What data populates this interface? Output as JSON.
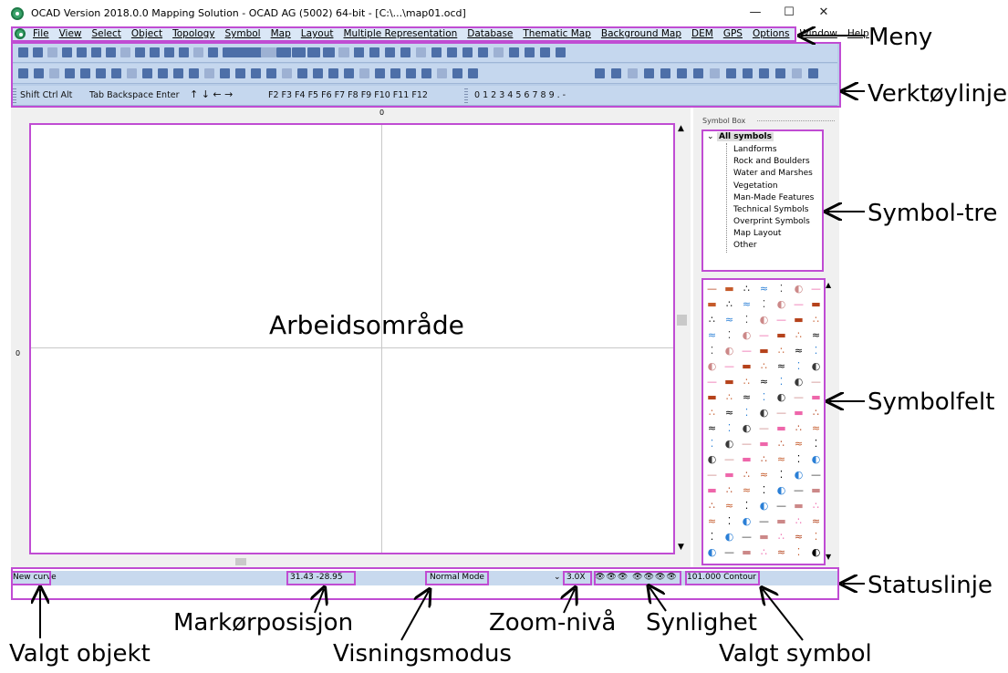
{
  "titlebar": {
    "title": "OCAD Version 2018.0.0  Mapping Solution - OCAD AG (5002) 64-bit - [C:\\...\\map01.ocd]",
    "minimize": "—",
    "maximize": "☐",
    "close": "✕"
  },
  "menu": {
    "items": [
      "File",
      "View",
      "Select",
      "Object",
      "Topology",
      "Symbol",
      "Map",
      "Layout",
      "Multiple Representation",
      "Database",
      "Thematic Map",
      "Background Map",
      "DEM",
      "GPS",
      "Options",
      "Window",
      "Help"
    ]
  },
  "keyboard_toolbar": {
    "keys": "Shift  Ctrl  Alt",
    "keys2": "Tab  Backspace  Enter",
    "fkeys": "F2  F3  F4  F5  F6  F7  F8  F9  F10  F11  F12",
    "digits": "0  1  2  3  4  5  6  7  8  9  .  -"
  },
  "rulers": {
    "top_zero": "0",
    "left_zero": "0"
  },
  "symbol_box": {
    "header": "Symbol Box",
    "root": "All symbols",
    "items": [
      "Landforms",
      "Rock and Boulders",
      "Water and Marshes",
      "Vegetation",
      "Man-Made Features",
      "Technical Symbols",
      "Overprint Symbols",
      "Map Layout",
      "Other"
    ]
  },
  "status": {
    "selected_object": "New curve",
    "cursor_position": "31.43  -28.95",
    "view_mode": "Normal Mode",
    "zoom": "3.0X",
    "selected_symbol": "101.000 Contour"
  },
  "annotations": {
    "meny": "Meny",
    "verktoy": "Verktøylinje",
    "symboltre": "Symbol-tre",
    "arbeidsomrade": "Arbeidsområde",
    "symbolfelt": "Symbolfelt",
    "statuslinje": "Statuslinje",
    "markorposisjon": "Markørposisjon",
    "zoomniva": "Zoom-nivå",
    "synlighet": "Synlighet",
    "valgt_objekt": "Valgt objekt",
    "visningsmodus": "Visningsmodus",
    "valgt_symbol": "Valgt symbol"
  },
  "colors": {
    "highlight": "#c04cd3",
    "toolbar": "#c5d7ee",
    "menubar": "#dae7f6",
    "accent_brown": "#b5421b"
  }
}
